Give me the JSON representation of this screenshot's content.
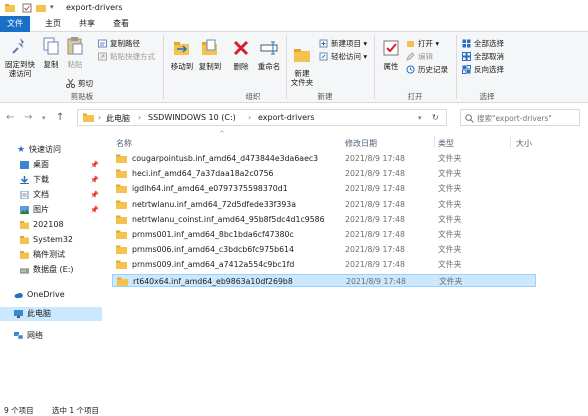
{
  "window": {
    "title": "export-drivers"
  },
  "tabs": {
    "file": "文件",
    "home": "主页",
    "share": "共享",
    "view": "查看"
  },
  "ribbon": {
    "clipboard": {
      "pin_quick_access": "固定到快速访问",
      "copy": "复制",
      "paste": "粘贴",
      "cut": "剪切",
      "copy_path": "复制路径",
      "paste_shortcut": "粘贴快捷方式",
      "group_label": "剪贴板"
    },
    "organize": {
      "move_to": "移动到",
      "copy_to": "复制到",
      "delete": "删除",
      "rename": "重命名",
      "group_label": "组织"
    },
    "new": {
      "new_folder": "新建\n文件夹",
      "new_item": "新建项目 ▾",
      "easy_access": "轻松访问 ▾",
      "group_label": "新建"
    },
    "open": {
      "properties": "属性",
      "open": "打开 ▾",
      "edit": "编辑",
      "history": "历史记录",
      "group_label": "打开"
    },
    "select": {
      "select_all": "全部选择",
      "select_none": "全部取消",
      "invert": "反向选择",
      "group_label": "选择"
    }
  },
  "address": {
    "crumbs": [
      "此电脑",
      "SSDWINDOWS 10 (C:)",
      "export-drivers"
    ],
    "search_placeholder": "搜索\"export-drivers\""
  },
  "nav": {
    "items": [
      {
        "label": "快速访问",
        "icon": "star-icon"
      },
      {
        "label": "桌面",
        "icon": "desktop-folder-icon",
        "pinned": true
      },
      {
        "label": "下载",
        "icon": "download-folder-icon",
        "pinned": true
      },
      {
        "label": "文档",
        "icon": "documents-folder-icon",
        "pinned": true
      },
      {
        "label": "图片",
        "icon": "pictures-folder-icon",
        "pinned": true
      },
      {
        "label": "202108",
        "icon": "folder-icon"
      },
      {
        "label": "System32",
        "icon": "folder-icon"
      },
      {
        "label": "稿件测试",
        "icon": "folder-icon"
      },
      {
        "label": "数据盘 (E:)",
        "icon": "drive-icon"
      },
      {
        "label": "OneDrive",
        "icon": "cloud-icon"
      },
      {
        "label": "此电脑",
        "icon": "pc-icon"
      },
      {
        "label": "网络",
        "icon": "network-icon"
      }
    ]
  },
  "list": {
    "columns": [
      "名称",
      "修改日期",
      "类型",
      "大小"
    ],
    "files": [
      {
        "name": "cougarpointusb.inf_amd64_d473844e3da6aec3",
        "date": "2021/8/9 17:48",
        "type": "文件夹"
      },
      {
        "name": "heci.inf_amd64_7a37daa18a2c0756",
        "date": "2021/8/9 17:48",
        "type": "文件夹"
      },
      {
        "name": "igdlh64.inf_amd64_e0797375598370d1",
        "date": "2021/8/9 17:48",
        "type": "文件夹"
      },
      {
        "name": "netrtwlanu.inf_amd64_72d5dfede33f393a",
        "date": "2021/8/9 17:48",
        "type": "文件夹"
      },
      {
        "name": "netrtwlanu_coinst.inf_amd64_95b8f5dc4d1c9586",
        "date": "2021/8/9 17:48",
        "type": "文件夹"
      },
      {
        "name": "prnms001.inf_amd64_8bc1bda6cf47380c",
        "date": "2021/8/9 17:48",
        "type": "文件夹"
      },
      {
        "name": "prnms006.inf_amd64_c3bdcb6fc975b614",
        "date": "2021/8/9 17:48",
        "type": "文件夹"
      },
      {
        "name": "prnms009.inf_amd64_a7412a554c9bc1fd",
        "date": "2021/8/9 17:48",
        "type": "文件夹"
      },
      {
        "name": "rt640x64.inf_amd64_eb9863a10df269b8",
        "date": "2021/8/9 17:48",
        "type": "文件夹",
        "selected": true
      }
    ]
  },
  "status": {
    "count": "9 个项目",
    "selected": "选中 1 个项目"
  },
  "colors": {
    "accent": "#1a6fc9",
    "selection": "#cce8ff",
    "folder": "#f3c24f"
  }
}
